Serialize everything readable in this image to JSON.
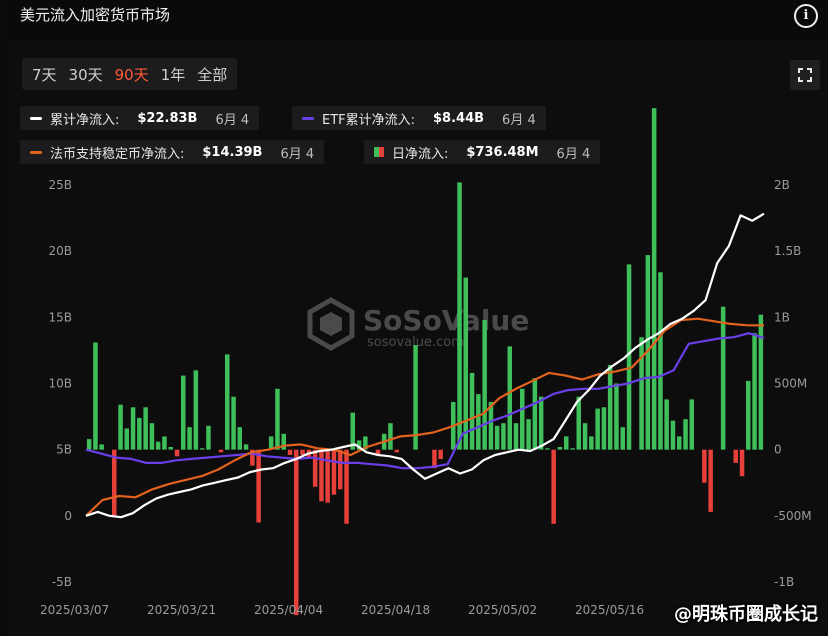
{
  "title": "美元流入加密货币市场",
  "info_icon": "info-circle-icon",
  "fullscreen_icon": "fullscreen-icon",
  "range_tabs": [
    {
      "label": "7天",
      "active": false
    },
    {
      "label": "30天",
      "active": false
    },
    {
      "label": "90天",
      "active": true
    },
    {
      "label": "1年",
      "active": false
    },
    {
      "label": "全部",
      "active": false
    }
  ],
  "legend": [
    {
      "name": "累计净流入:",
      "value": "$22.83B",
      "date": "6月 4",
      "color": "#ffffff",
      "kind": "line"
    },
    {
      "name": "ETF累计净流入:",
      "value": "$8.44B",
      "date": "6月 4",
      "color": "#6a3fe8",
      "kind": "line"
    },
    {
      "name": "法币支持稳定币净流入:",
      "value": "$14.39B",
      "date": "6月 4",
      "color": "#e3621d",
      "kind": "line"
    },
    {
      "name": "日净流入:",
      "value": "$736.48M",
      "date": "6月 4",
      "color_pos": "#3fbf5a",
      "color_neg": "#e5403a",
      "kind": "bar"
    }
  ],
  "watermark": {
    "brand": "SoSoValue",
    "site": "sosovalue.com"
  },
  "credit": "@明珠币圈成长记",
  "colors": {
    "accent": "#ff5a36",
    "bar_pos": "#3fbf5a",
    "bar_neg": "#e5403a",
    "cum": "#ffffff",
    "etf": "#6a3fe8",
    "stable": "#e3621d"
  },
  "chart_data": {
    "type": "bar+line",
    "x_start": "2025/03/07",
    "x_ticks": [
      "2025/03/07",
      "2025/03/21",
      "2025/04/04",
      "2025/04/18",
      "2025/05/02",
      "2025/05/16"
    ],
    "y_left": {
      "ticks": [
        "-5B",
        "0",
        "5B",
        "10B",
        "15B",
        "20B",
        "25B"
      ],
      "min": -5,
      "max": 25,
      "unit": "B"
    },
    "y_right": {
      "ticks": [
        "-1B",
        "-500M",
        "0",
        "500M",
        "1B",
        "1.5B",
        "2B"
      ],
      "min": -1000,
      "max": 2000,
      "unit": "M"
    },
    "grid": false,
    "daily_net_inflow_M": [
      80,
      810,
      40,
      0,
      -500,
      340,
      160,
      320,
      240,
      320,
      200,
      60,
      100,
      20,
      -50,
      560,
      170,
      600,
      10,
      180,
      0,
      -20,
      720,
      400,
      170,
      40,
      -120,
      -550,
      0,
      100,
      460,
      120,
      -40,
      -1250,
      -40,
      -60,
      -280,
      -390,
      -400,
      -340,
      -300,
      -560,
      280,
      70,
      100,
      0,
      -40,
      120,
      200,
      -20,
      0,
      0,
      790,
      0,
      0,
      -140,
      -70,
      0,
      360,
      2020,
      1300,
      580,
      420,
      980,
      360,
      180,
      200,
      780,
      200,
      460,
      230,
      540,
      400,
      10,
      -560,
      20,
      100,
      10,
      400,
      200,
      100,
      310,
      320,
      640,
      500,
      170,
      1400,
      0,
      850,
      1470,
      2580,
      1340,
      380,
      220,
      100,
      230,
      380,
      0,
      -250,
      -470,
      0,
      1080,
      0,
      -100,
      -200,
      520,
      880,
      1020
    ],
    "series": [
      {
        "name": "累计净流入",
        "unit": "B",
        "values": [
          0,
          0.3,
          0,
          -0.1,
          0.2,
          0.8,
          1.3,
          1.6,
          1.8,
          2.0,
          2.3,
          2.5,
          2.7,
          2.9,
          3.3,
          3.5,
          3.6,
          4.0,
          4.3,
          4.7,
          4.9,
          5.0,
          5.2,
          5.4,
          4.8,
          4.6,
          4.5,
          4.3,
          3.5,
          2.8,
          3.2,
          3.6,
          3.2,
          3.5,
          4.2,
          4.6,
          4.8,
          5.0,
          4.9,
          5.3,
          5.8,
          7.2,
          8.6,
          9.5,
          10.6,
          11.3,
          11.9,
          12.7,
          13.3,
          13.8,
          14.5,
          14.9,
          15.5,
          16.3,
          19.1,
          20.4,
          22.7,
          22.3,
          22.83
        ]
      },
      {
        "name": "ETF累计净流入",
        "unit": "B",
        "values": [
          0,
          -0.3,
          -0.6,
          -0.7,
          -1.0,
          -1.0,
          -0.8,
          -0.7,
          -0.6,
          -0.5,
          -0.4,
          -0.3,
          -0.5,
          -0.6,
          -0.7,
          -0.6,
          -0.8,
          -1.0,
          -1.0,
          -1.1,
          -1.2,
          -1.4,
          -1.4,
          -1.3,
          -1.1,
          1.2,
          1.7,
          2.2,
          2.6,
          3.1,
          3.6,
          4.2,
          4.5,
          4.6,
          4.6,
          4.8,
          5.0,
          5.4,
          5.5,
          6.0,
          8.0,
          8.2,
          8.4,
          8.5,
          8.8,
          8.44
        ]
      },
      {
        "name": "法币支持稳定币净流入",
        "unit": "B",
        "values": [
          0,
          1.2,
          1.5,
          1.4,
          2.0,
          2.4,
          2.7,
          3.0,
          3.5,
          4.2,
          4.8,
          5.0,
          5.3,
          5.4,
          5.1,
          5.0,
          4.6,
          5.2,
          5.6,
          6.0,
          6.1,
          6.3,
          6.7,
          7.2,
          7.7,
          8.9,
          9.6,
          10.2,
          10.8,
          10.6,
          10.3,
          10.7,
          10.9,
          11.2,
          12.5,
          14.0,
          14.8,
          14.9,
          14.7,
          14.5,
          14.4,
          14.39
        ]
      }
    ]
  }
}
